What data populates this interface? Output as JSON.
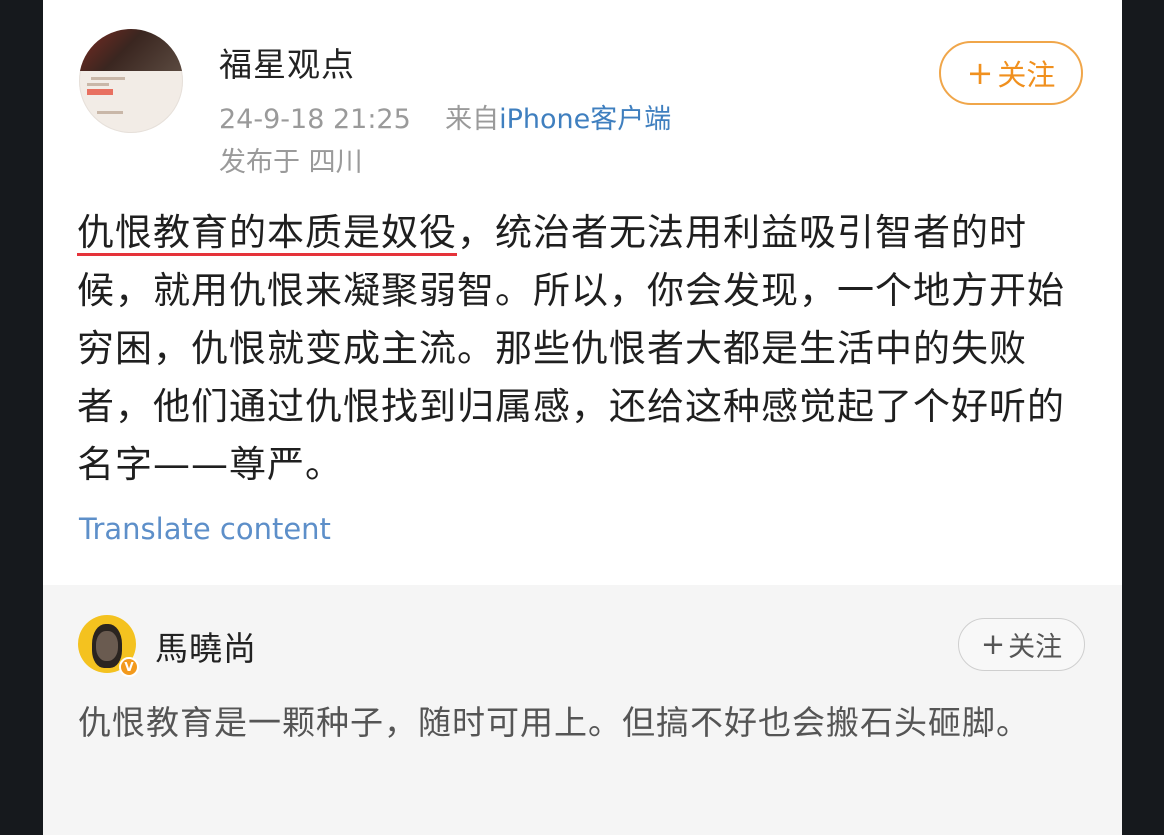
{
  "post": {
    "author_name": "福星观点",
    "timestamp": "24-9-18 21:25",
    "source_prefix": "来自",
    "source_device": "iPhone客户端",
    "location": "发布于 四川",
    "follow_label": "关注",
    "highlighted_text": "仇恨教育的本质是奴役",
    "body_rest": "，统治者无法用利益吸引智者的时候，就用仇恨来凝聚弱智。所以，你会发现，一个地方开始穷困，仇恨就变成主流。那些仇恨者大都是生活中的失败者，他们通过仇恨找到归属感，还给这种感觉起了个好听的名字——尊严。",
    "translate_label": "Translate content",
    "highlight_color": "#e5333a",
    "follow_color": "#f0901e"
  },
  "comment": {
    "author_name": "馬曉尚",
    "follow_label": "关注",
    "verified_badge": "V",
    "text": "仇恨教育是一颗种子，随时可用上。但搞不好也会搬石头砸脚。"
  },
  "icons": {
    "plus": "+"
  }
}
